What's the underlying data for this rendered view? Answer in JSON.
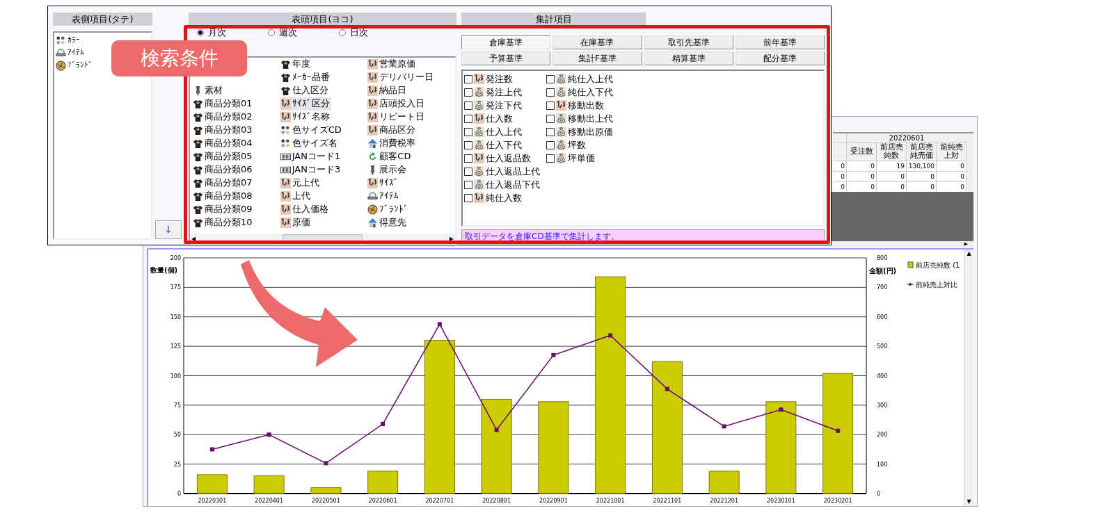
{
  "callout": {
    "label": "検索条件"
  },
  "scroll_arrows": {
    "table_right": "▶",
    "chart_up": "▲",
    "chart_down": "▼",
    "list_left": "◀",
    "list_right": "▶"
  },
  "row_panel": {
    "title": "表側項目(タテ)",
    "items": [
      {
        "label": "ｶﾗｰ",
        "kind": "dots"
      },
      {
        "label": "ｱｲﾃﾑ",
        "kind": "cap"
      },
      {
        "label": "ﾌﾞﾗﾝﾄﾞ",
        "kind": "ball"
      }
    ],
    "move_button": "↓"
  },
  "column_panel": {
    "title": "表頭項目(ヨコ)",
    "periods": [
      {
        "label": "月次",
        "selected": true
      },
      {
        "label": "週次",
        "selected": false
      },
      {
        "label": "日次",
        "selected": false
      }
    ],
    "item_columns": [
      {
        "items": [
          {
            "label": "素材",
            "kind": "figure",
            "selected": false
          },
          {
            "label": "商品分類01",
            "kind": "shirt",
            "selected": false
          },
          {
            "label": "商品分類02",
            "kind": "shirt",
            "selected": false
          },
          {
            "label": "商品分類03",
            "kind": "shirt",
            "selected": false
          },
          {
            "label": "商品分類04",
            "kind": "shirt",
            "selected": false
          },
          {
            "label": "商品分類05",
            "kind": "shirt",
            "selected": false
          },
          {
            "label": "商品分類06",
            "kind": "shirt",
            "selected": false
          },
          {
            "label": "商品分類07",
            "kind": "shirt",
            "selected": false
          },
          {
            "label": "商品分類08",
            "kind": "shirt",
            "selected": false
          },
          {
            "label": "商品分類09",
            "kind": "shirt",
            "selected": false
          },
          {
            "label": "商品分類10",
            "kind": "shirt",
            "selected": false
          }
        ]
      },
      {
        "items": [
          {
            "label": "年度",
            "kind": "shirt",
            "selected": false
          },
          {
            "label": "ﾒｰｶｰ品番",
            "kind": "shirt",
            "selected": false
          },
          {
            "label": "仕入区分",
            "kind": "shirt",
            "selected": false
          },
          {
            "label": "ｻｲｽﾞ区分",
            "kind": "number",
            "selected": true
          },
          {
            "label": "ｻｲｽﾞ名称",
            "kind": "number",
            "selected": false
          },
          {
            "label": "色サイズCD",
            "kind": "dots",
            "selected": false
          },
          {
            "label": "色サイズ名",
            "kind": "dots",
            "selected": false
          },
          {
            "label": "JANコード1",
            "kind": "barcode",
            "selected": false
          },
          {
            "label": "JANコード3",
            "kind": "barcode",
            "selected": false
          },
          {
            "label": "元上代",
            "kind": "number",
            "selected": false
          },
          {
            "label": "上代",
            "kind": "number",
            "selected": false
          },
          {
            "label": "仕入価格",
            "kind": "number",
            "selected": false
          },
          {
            "label": "原価",
            "kind": "number",
            "selected": false
          }
        ]
      },
      {
        "items": [
          {
            "label": "営業原価",
            "kind": "number",
            "selected": false
          },
          {
            "label": "デリバリー日",
            "kind": "number",
            "selected": false
          },
          {
            "label": "納品日",
            "kind": "number",
            "selected": false
          },
          {
            "label": "店頭投入日",
            "kind": "number",
            "selected": false
          },
          {
            "label": "リピート日",
            "kind": "number",
            "selected": false
          },
          {
            "label": "商品区分",
            "kind": "number",
            "selected": false
          },
          {
            "label": "消費税率",
            "kind": "house",
            "selected": false
          },
          {
            "label": "顧客CD",
            "kind": "cycle",
            "selected": false
          },
          {
            "label": "展示会",
            "kind": "figure",
            "selected": false
          },
          {
            "label": "ｻｲｽﾞ",
            "kind": "number",
            "selected": false
          },
          {
            "label": "ｱｲﾃﾑ",
            "kind": "cap",
            "selected": false
          },
          {
            "label": "ﾌﾞﾗﾝﾄﾞ",
            "kind": "ball",
            "selected": false
          },
          {
            "label": "得意先",
            "kind": "house",
            "selected": false
          }
        ]
      }
    ]
  },
  "total_panel": {
    "title": "集計項目",
    "bases": [
      {
        "label": "倉庫基準",
        "selected": true
      },
      {
        "label": "在庫基準",
        "selected": false
      },
      {
        "label": "取引先基準",
        "selected": false
      },
      {
        "label": "前年基準",
        "selected": false
      },
      {
        "label": "予算基準",
        "selected": false
      },
      {
        "label": "集計F基準",
        "selected": false
      },
      {
        "label": "精算基準",
        "selected": false
      },
      {
        "label": "配分基準",
        "selected": false
      }
    ],
    "check_columns": [
      {
        "items": [
          {
            "label": "発注数",
            "kind": "number",
            "checked": false
          },
          {
            "label": "発注上代",
            "kind": "bag",
            "checked": false
          },
          {
            "label": "発注下代",
            "kind": "bag",
            "checked": false
          },
          {
            "label": "仕入数",
            "kind": "number",
            "checked": false
          },
          {
            "label": "仕入上代",
            "kind": "bag",
            "checked": false
          },
          {
            "label": "仕入下代",
            "kind": "bag",
            "checked": false
          },
          {
            "label": "仕入返品数",
            "kind": "number",
            "checked": false
          },
          {
            "label": "仕入返品上代",
            "kind": "bag",
            "checked": false
          },
          {
            "label": "仕入返品下代",
            "kind": "bag",
            "checked": false
          },
          {
            "label": "純仕入数",
            "kind": "number",
            "checked": false
          }
        ]
      },
      {
        "items": [
          {
            "label": "純仕入上代",
            "kind": "bag",
            "checked": false
          },
          {
            "label": "純仕入下代",
            "kind": "bag",
            "checked": false
          },
          {
            "label": "移動出数",
            "kind": "number",
            "checked": false
          },
          {
            "label": "移動出上代",
            "kind": "bag",
            "checked": false
          },
          {
            "label": "移動出原価",
            "kind": "bag",
            "checked": false
          },
          {
            "label": "坪数",
            "kind": "bag",
            "checked": false
          },
          {
            "label": "坪単価",
            "kind": "bag",
            "checked": false
          }
        ]
      }
    ],
    "message": "取引データを倉庫CD基準で集計します。"
  },
  "table": {
    "group_header": "20220601",
    "columns": [
      "",
      "受注数",
      "前店売純数",
      "前店売純売価",
      "前純売上対"
    ],
    "rows": [
      [
        "0",
        "0",
        "19",
        "130,100",
        "0"
      ],
      [
        "0",
        "0",
        "0",
        "0",
        "0"
      ],
      [
        "0",
        "0",
        "0",
        "0",
        "0"
      ]
    ]
  },
  "chart": {
    "chart_data": {
      "type": "bar",
      "grid": true,
      "legend": "right",
      "ylabel": "数量(個)",
      "y2label": "金額(円)",
      "categories": [
        "20220301",
        "20220401",
        "20220501",
        "20220601",
        "20220701",
        "20220801",
        "20220901",
        "20221001",
        "20221101",
        "20221201",
        "20230101",
        "20230201"
      ],
      "ylim": [
        0,
        200
      ],
      "yticks": [
        0,
        25,
        50,
        75,
        100,
        125,
        150,
        175,
        200
      ],
      "y2lim": [
        0,
        800
      ],
      "y2ticks": [
        0,
        100,
        200,
        300,
        400,
        500,
        600,
        700,
        800
      ],
      "series": [
        {
          "name": "前店売純数 (1",
          "color": "#cccc00",
          "values": [
            16,
            15,
            5,
            19,
            130,
            80,
            78,
            184,
            112,
            19,
            78,
            102
          ]
        },
        {
          "name": "前純売上対比",
          "type": "line",
          "axis": "y2",
          "marker": "square",
          "color": "#6a0a6e",
          "values": [
            150,
            200,
            103,
            236,
            575,
            216,
            470,
            537,
            355,
            228,
            285,
            213
          ]
        }
      ]
    }
  }
}
